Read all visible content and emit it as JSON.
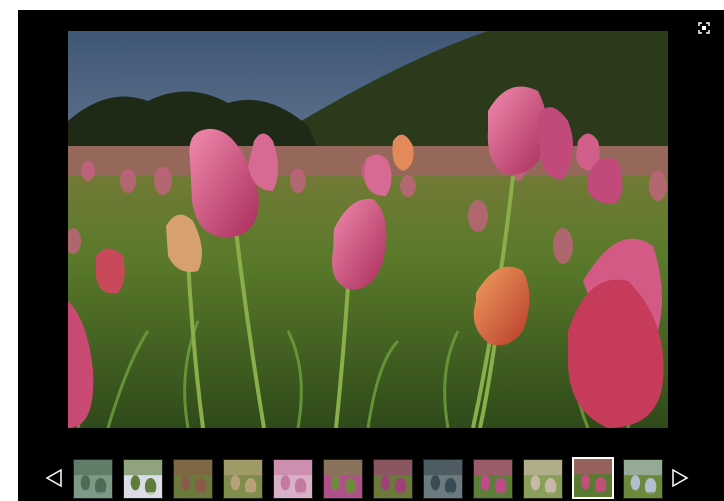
{
  "gallery": {
    "background": "#000000",
    "controls": {
      "fullscreen_icon": "fullscreen-icon",
      "prev_icon": "triangle-left-outline-icon",
      "next_icon": "triangle-right-outline-icon"
    },
    "main_image": {
      "subject": "tulip-field-photo"
    },
    "thumbnails": [
      {
        "subject": "cabbage-rows",
        "colors": [
          "#4f6b55",
          "#7d9a86"
        ]
      },
      {
        "subject": "person-in-field",
        "colors": [
          "#5f7d3a",
          "#d9dde5"
        ]
      },
      {
        "subject": "flower-rows",
        "colors": [
          "#8a5a4a",
          "#6b7a3a"
        ]
      },
      {
        "subject": "tulips-pale",
        "colors": [
          "#b8a27a",
          "#7e8e4a"
        ]
      },
      {
        "subject": "tulips-pink",
        "colors": [
          "#c47aa0",
          "#d8b0c8"
        ]
      },
      {
        "subject": "tulips-magenta",
        "colors": [
          "#6f8a3a",
          "#b0508a"
        ]
      },
      {
        "subject": "purple-flowers",
        "colors": [
          "#a0407a",
          "#6a7a3a"
        ]
      },
      {
        "subject": "dark-leaves",
        "colors": [
          "#3a4a52",
          "#6b7b80"
        ]
      },
      {
        "subject": "pink-tulips-close",
        "colors": [
          "#c04a8a",
          "#5f7d3a"
        ]
      },
      {
        "subject": "hillside-field",
        "colors": [
          "#c8b8a8",
          "#8aa05a"
        ]
      },
      {
        "subject": "tulip-field-current",
        "colors": [
          "#c0507a",
          "#5a7a32"
        ],
        "selected": true
      },
      {
        "subject": "field-with-statue",
        "colors": [
          "#b0c0d0",
          "#6a8a3a"
        ]
      }
    ]
  }
}
